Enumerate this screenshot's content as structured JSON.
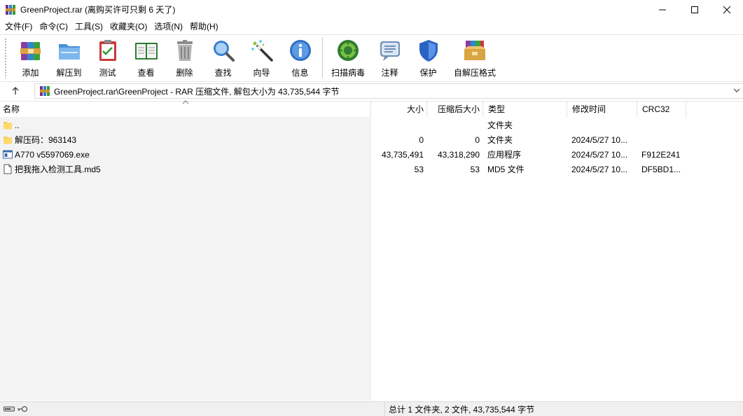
{
  "window": {
    "title": "GreenProject.rar (离购买许可只剩 6 天了)"
  },
  "menu": {
    "items": [
      "文件(F)",
      "命令(C)",
      "工具(S)",
      "收藏夹(O)",
      "选项(N)",
      "帮助(H)"
    ]
  },
  "toolbar": {
    "add": "添加",
    "extract": "解压到",
    "test": "测试",
    "view": "查看",
    "delete": "删除",
    "find": "查找",
    "wizard": "向导",
    "info": "信息",
    "virus": "扫描病毒",
    "comment": "注释",
    "protect": "保护",
    "sfx": "自解压格式"
  },
  "address": {
    "path": "GreenProject.rar\\GreenProject - RAR 压缩文件, 解包大小为 43,735,544 字节"
  },
  "columns": {
    "name": "名称",
    "size": "大小",
    "packed": "压缩后大小",
    "type": "类型",
    "modified": "修改时间",
    "crc": "CRC32"
  },
  "files": [
    {
      "icon": "folder-up-icon",
      "name": "..",
      "size": "",
      "packed": "",
      "type": "文件夹",
      "modified": "",
      "crc": ""
    },
    {
      "icon": "folder-icon",
      "name": "解压码：963143",
      "size": "0",
      "packed": "0",
      "type": "文件夹",
      "modified": "2024/5/27 10...",
      "crc": ""
    },
    {
      "icon": "exe-icon",
      "name": "A770 v5597069.exe",
      "size": "43,735,491",
      "packed": "43,318,290",
      "type": "应用程序",
      "modified": "2024/5/27 10...",
      "crc": "F912E241"
    },
    {
      "icon": "file-icon",
      "name": "把我拖入检测工具.md5",
      "size": "53",
      "packed": "53",
      "type": "MD5 文件",
      "modified": "2024/5/27 10...",
      "crc": "DF5BD1..."
    }
  ],
  "status": {
    "summary": "总计 1 文件夹, 2 文件, 43,735,544 字节"
  }
}
